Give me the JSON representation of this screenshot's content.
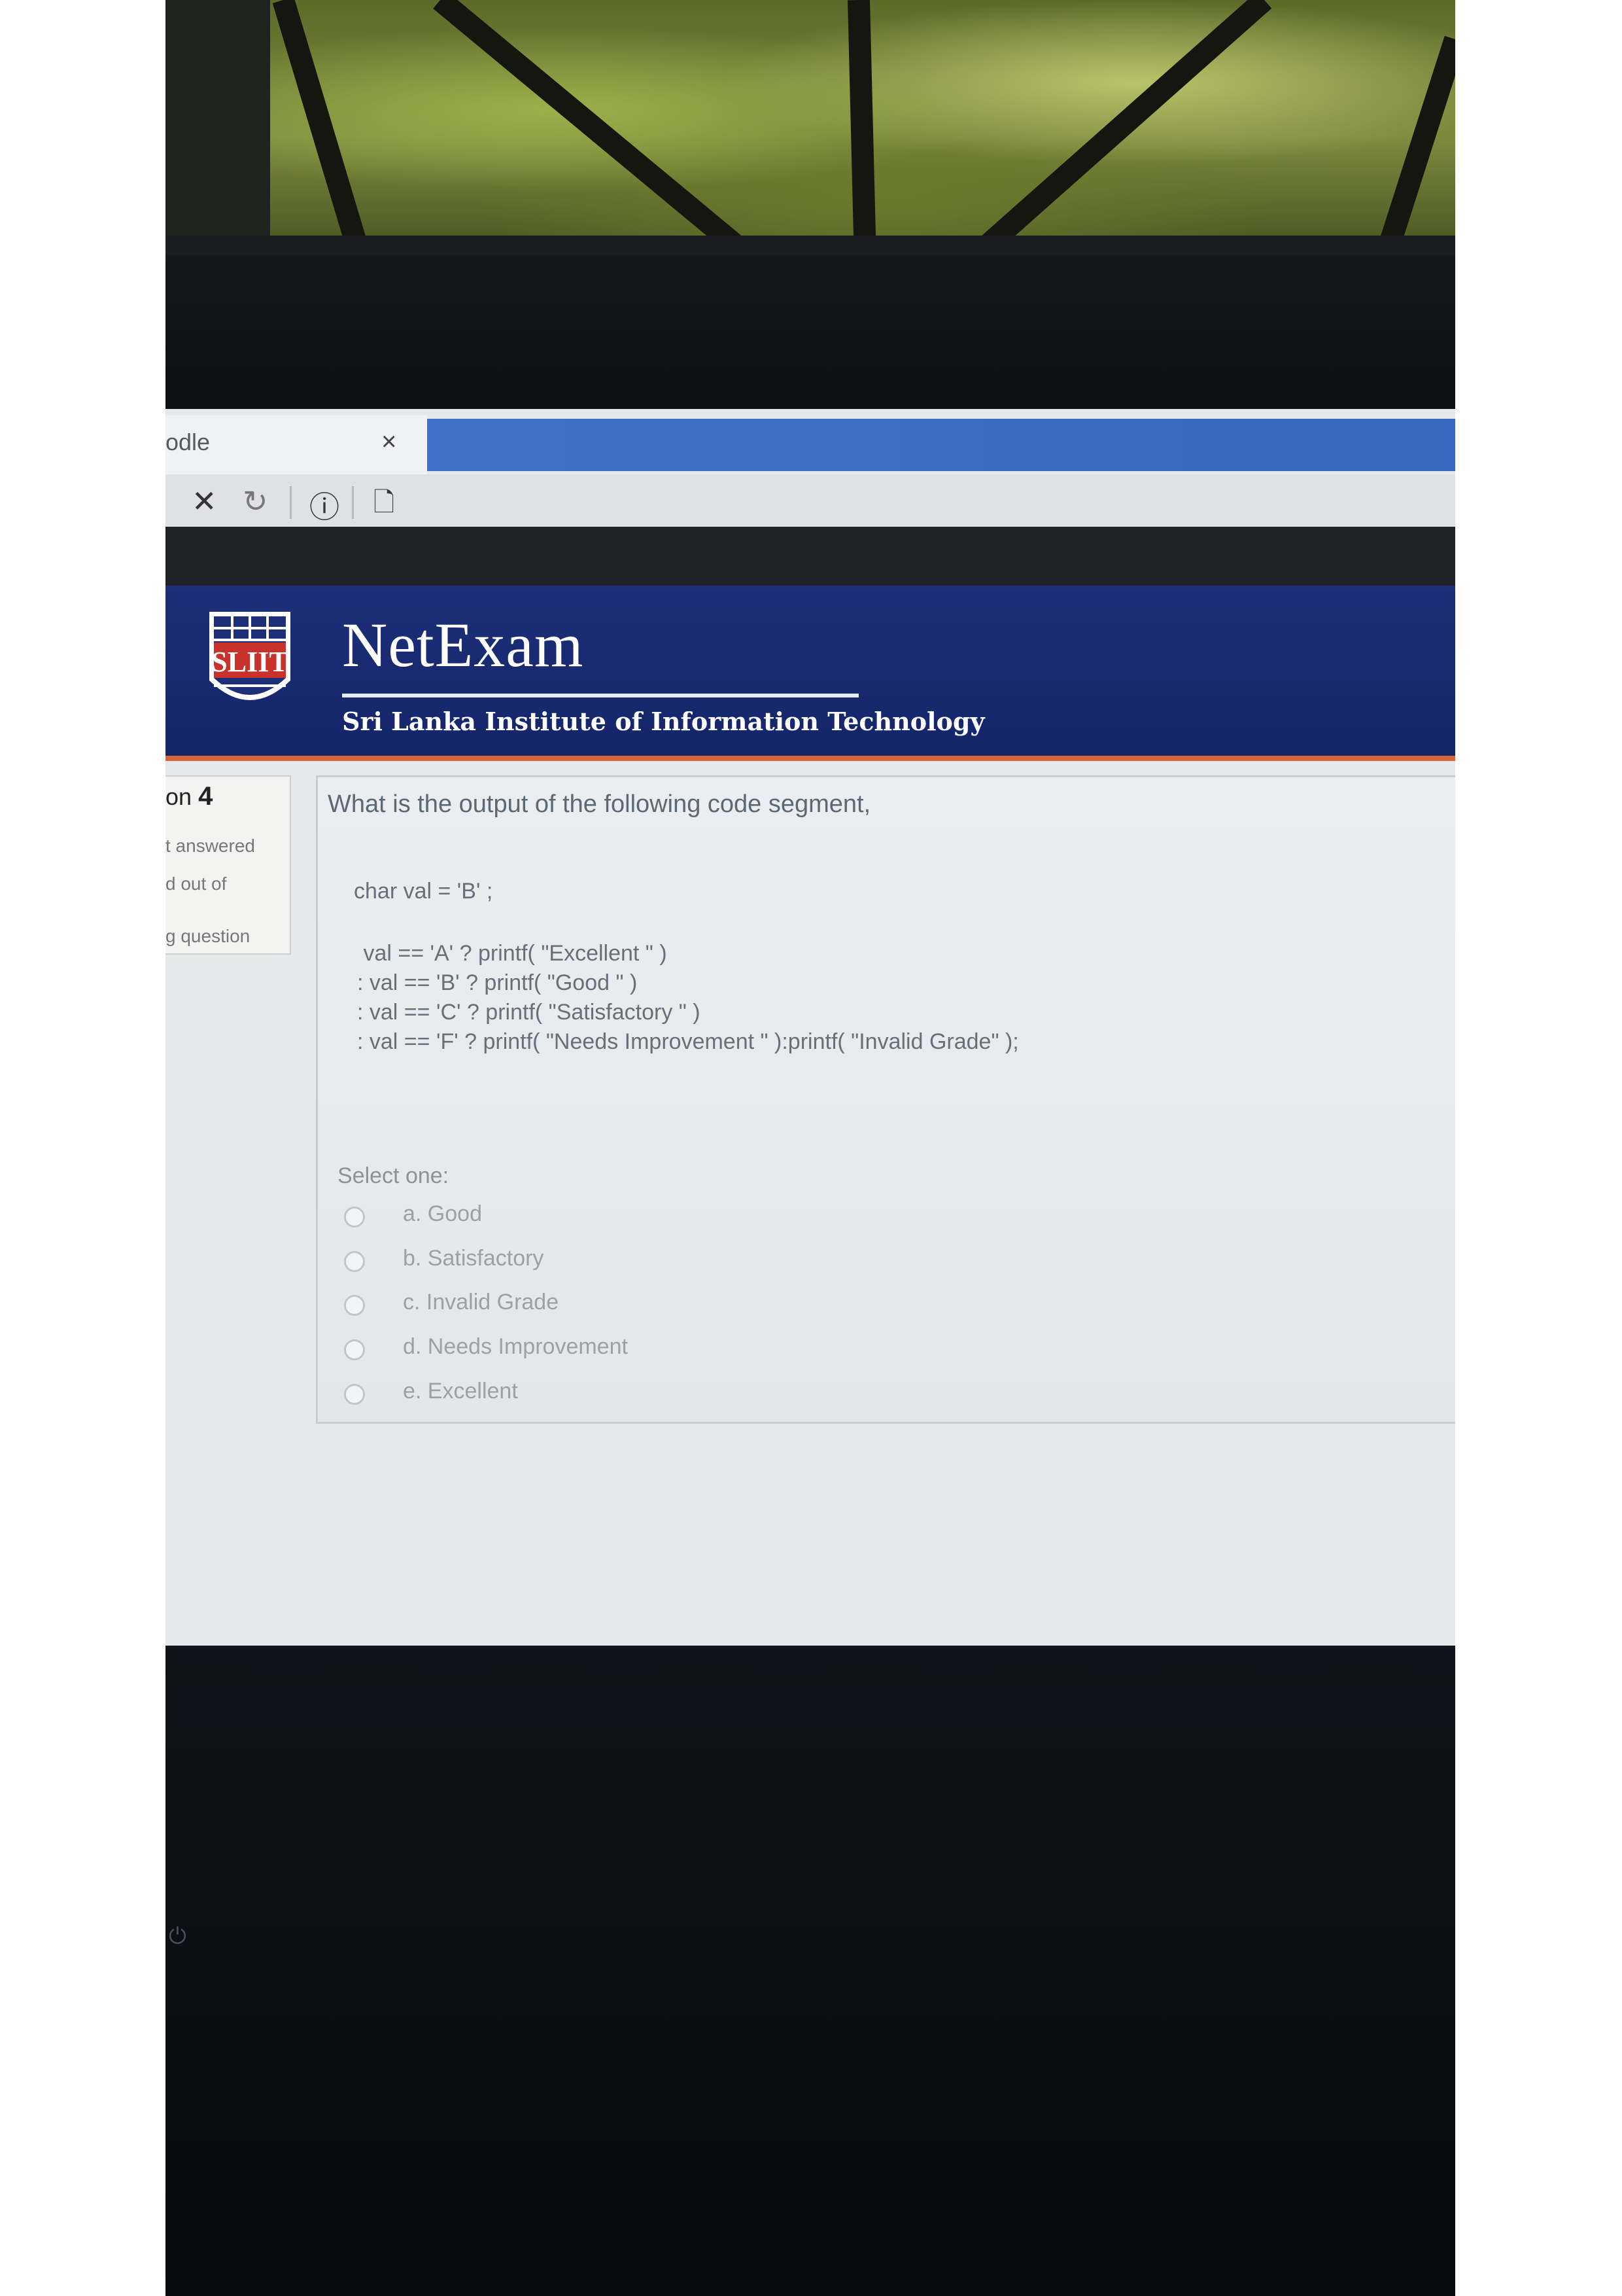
{
  "browser": {
    "tab_title": "odle",
    "tab_close": "×",
    "toolbar": {
      "stop_icon": "✕",
      "reload_icon": "↻",
      "info_icon": "ⓘ",
      "page_icon": "🗋"
    }
  },
  "header": {
    "brand": "NetExam",
    "subtitle": "Sri Lanka Institute of Information Technology",
    "logo_text": "SLIIT"
  },
  "question_nav": {
    "number_prefix": "on",
    "number": "4",
    "status": "t answered",
    "marks": "d out of",
    "flag": "g question"
  },
  "question": {
    "text": "What is the output of the following code segment,",
    "declaration": "char val = 'B' ;",
    "code_lines": [
      " val == 'A' ? printf( \"Excellent \" )",
      ": val == 'B' ? printf( \"Good \" )",
      ": val == 'C' ? printf( \"Satisfactory \" )",
      ": val == 'F' ? printf( \"Needs Improvement \" ):printf( \"Invalid Grade\" );"
    ],
    "select_prompt": "Select one:",
    "options": [
      "a. Good",
      "b. Satisfactory",
      "c. Invalid Grade",
      "d. Needs Improvement",
      "e. Excellent"
    ]
  }
}
